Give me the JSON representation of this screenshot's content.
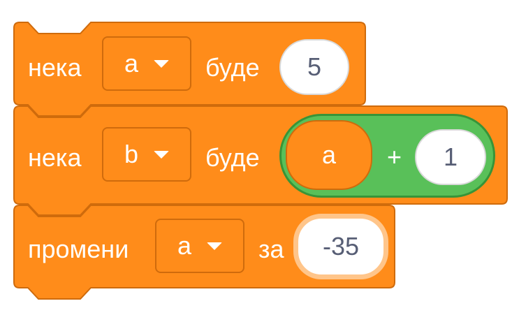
{
  "blocks": {
    "set_a": {
      "label_set": "нека",
      "variable": "a",
      "label_to": "буде",
      "value": "5"
    },
    "set_b": {
      "label_set": "нека",
      "variable": "b",
      "label_to": "буде",
      "operator": {
        "left_variable": "a",
        "sign": "+",
        "right_value": "1"
      }
    },
    "change_a": {
      "label_change": "промени",
      "variable": "a",
      "label_by": "за",
      "value": "-35"
    }
  },
  "colors": {
    "variables_block": "#ff8c1a",
    "variables_border": "#cf6b0c",
    "operators_block": "#59c059",
    "operators_border": "#389438",
    "input_text": "#575e75",
    "focus_ring": "#ffc58a"
  },
  "icons": {
    "dropdown": "caret-down-icon"
  }
}
